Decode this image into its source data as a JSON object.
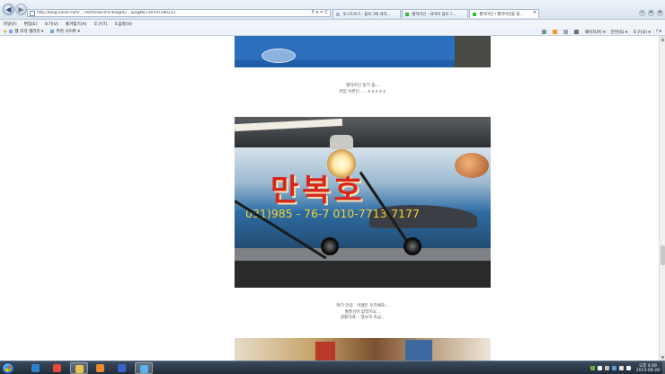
{
  "browser": {
    "url": "http://blog.naver.com/... PostView.nhn?blogId=...&logNo=40197280233",
    "addr_tools": "ℙ ▾ ✕ C",
    "tabs": [
      {
        "label": "포스트쓰기 : 블로그에 네이...",
        "active": false
      },
      {
        "label": "월하어인 : 네이버 블로그...",
        "active": false
      },
      {
        "label": "월하어인 / 월하어인을 탈...",
        "active": true
      }
    ],
    "window_controls": {
      "minimize": "–",
      "maximize": "□",
      "close": "×"
    },
    "menu": [
      "파일(F)",
      "편집(E)",
      "보기(V)",
      "즐겨찾기(A)",
      "도구(T)",
      "도움말(H)"
    ],
    "favorites": {
      "star": "★",
      "items": [
        "웹 조각 갤러리 ▾",
        "추천 사이트 ▾"
      ]
    },
    "command_bar": [
      "페이지(P) ▾",
      "안전(S) ▾",
      "도구(O) ▾",
      "? ▾"
    ]
  },
  "post": {
    "caption1": [
      "월하어인 닻기 좀...",
      "저입 어른인..... ㅎㅎㅎㅎㅎ"
    ],
    "sign": {
      "name": "만복호",
      "phone": "031)985 - 76-7 010-7713-7177"
    },
    "caption2": [
      "여기 안녕 . 어쨌든 우리배로...",
      "월풍선이 없었어요...",
      "생활하게... 행쇼하 조금..."
    ]
  },
  "taskbar": {
    "apps": [
      {
        "name": "ie",
        "color": "#2f7fd1",
        "active": false
      },
      {
        "name": "chrome",
        "color": "#e8473b",
        "active": false
      },
      {
        "name": "explorer",
        "color": "#e7c15a",
        "active": true
      },
      {
        "name": "media",
        "color": "#e88b2c",
        "active": false
      },
      {
        "name": "app",
        "color": "#3a5fc7",
        "active": false
      },
      {
        "name": "ie-active",
        "color": "#5bb2ea",
        "active": true
      }
    ],
    "tray_icons": [
      "#6fae43",
      "#ffffff",
      "#c2c2c2",
      "#56a0e0",
      "#e0e0e0",
      "#f0f0f0"
    ],
    "time": "오후 4:49",
    "date": "2013-09-28"
  },
  "colors": {
    "accent": "#2f7fd1",
    "sign_red": "#d8261b",
    "phone_yellow": "#f5d431"
  }
}
